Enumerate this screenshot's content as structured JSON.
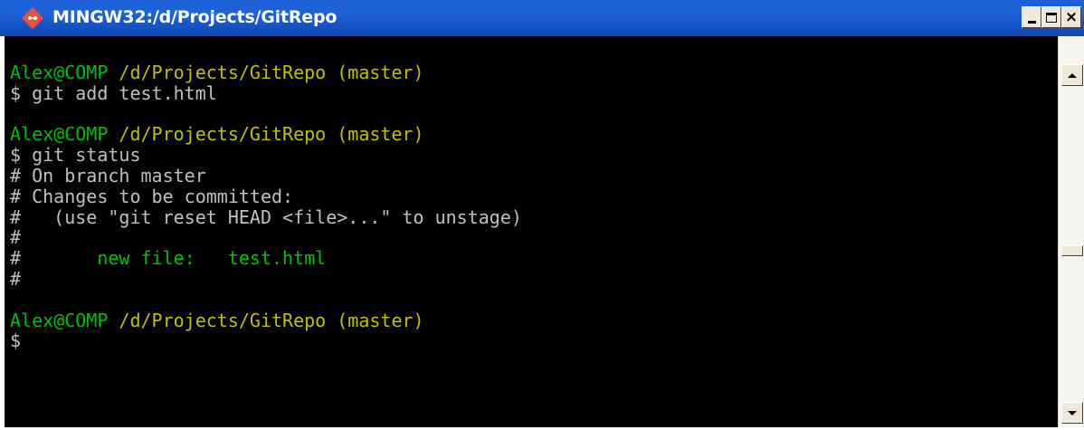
{
  "window": {
    "title": "MINGW32:/d/Projects/GitRepo",
    "icon": "git-icon",
    "controls": {
      "minimize": "minimize-icon",
      "maximize": "maximize-icon",
      "close": "close-icon",
      "close_glyph": "×"
    }
  },
  "colors": {
    "titlebar": "#1f63dc",
    "console_bg": "#000000",
    "user_host": "#00c000",
    "path": "#c0c000",
    "text": "#c0c0c0",
    "git_icon": "#f05033"
  },
  "terminal": {
    "lines": [
      {
        "parts": [
          {
            "text": "Alex@COMP",
            "color": "green"
          },
          {
            "text": " /d/Projects/GitRepo (master)",
            "color": "yellow"
          }
        ]
      },
      {
        "parts": [
          {
            "text": "$ git add test.html",
            "color": "white"
          }
        ]
      },
      {
        "parts": [
          {
            "text": "",
            "color": "white"
          }
        ]
      },
      {
        "parts": [
          {
            "text": "Alex@COMP",
            "color": "green"
          },
          {
            "text": " /d/Projects/GitRepo (master)",
            "color": "yellow"
          }
        ]
      },
      {
        "parts": [
          {
            "text": "$ git status",
            "color": "white"
          }
        ]
      },
      {
        "parts": [
          {
            "text": "# On branch master",
            "color": "white"
          }
        ]
      },
      {
        "parts": [
          {
            "text": "# Changes to be committed:",
            "color": "white"
          }
        ]
      },
      {
        "parts": [
          {
            "text": "#   (use \"git reset HEAD <file>...\" to unstage)",
            "color": "white"
          }
        ]
      },
      {
        "parts": [
          {
            "text": "#",
            "color": "white"
          }
        ]
      },
      {
        "parts": [
          {
            "text": "#",
            "color": "white"
          },
          {
            "text": "       new file:   test.html",
            "color": "green"
          }
        ]
      },
      {
        "parts": [
          {
            "text": "#",
            "color": "white"
          }
        ]
      },
      {
        "parts": [
          {
            "text": "",
            "color": "white"
          }
        ]
      },
      {
        "parts": [
          {
            "text": "Alex@COMP",
            "color": "green"
          },
          {
            "text": " /d/Projects/GitRepo (master)",
            "color": "yellow"
          }
        ]
      },
      {
        "parts": [
          {
            "text": "$",
            "color": "white"
          }
        ]
      }
    ]
  },
  "scrollbar": {
    "up_icon": "scroll-up-arrow-icon",
    "down_icon": "scroll-down-arrow-icon"
  }
}
